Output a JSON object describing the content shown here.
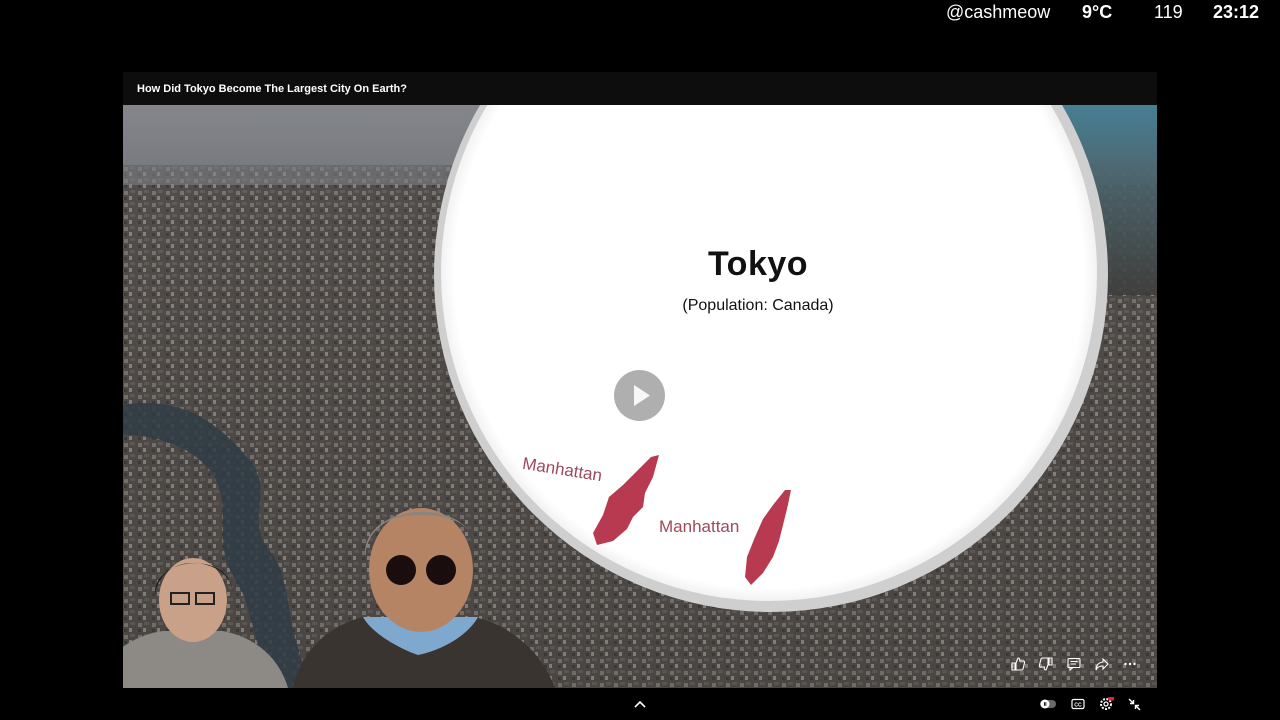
{
  "overlay": {
    "username": "@cashmeow",
    "temperature": "9°C",
    "count": "119",
    "time": "23:12"
  },
  "video": {
    "title": "How Did Tokyo Become The Largest City On Earth?",
    "city": "Tokyo",
    "population_note": "(Population: Canada)",
    "label_1": "Manhattan",
    "label_2": "Manhattan"
  },
  "controls": {
    "icons": [
      "thumbs-up-icon",
      "thumbs-down-icon",
      "comment-icon",
      "share-icon",
      "more-icon"
    ]
  },
  "bottombar": {
    "icons": [
      "chevron-up-icon",
      "autoplay-icon",
      "captions-icon",
      "settings-icon",
      "exit-fullscreen-icon"
    ]
  },
  "colors": {
    "manhattan": "#b73a50",
    "label": "#9c4a5c"
  }
}
